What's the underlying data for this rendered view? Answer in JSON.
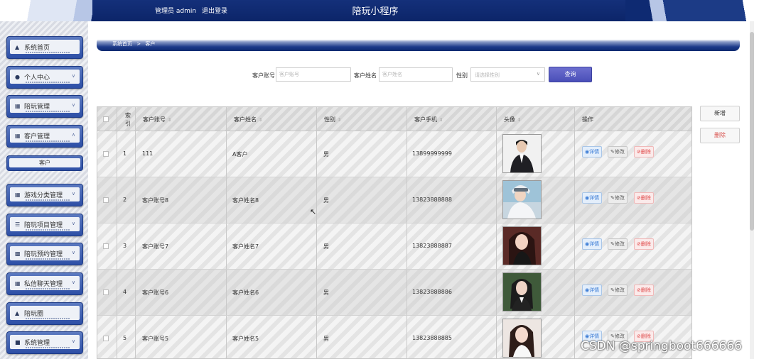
{
  "header": {
    "admin_role": "管理员 admin",
    "logout_label": "退出登录",
    "app_title": "陪玩小程序"
  },
  "sidebar": {
    "items": [
      {
        "label": "系统首页",
        "icon": "home-icon"
      },
      {
        "label": "个人中心",
        "icon": "user-icon"
      },
      {
        "label": "陪玩管理",
        "icon": "grid-icon"
      },
      {
        "label": "客户管理",
        "icon": "grid-icon"
      },
      {
        "label": "游戏分类管理",
        "icon": "grid-icon"
      },
      {
        "label": "陪玩项目管理",
        "icon": "list-icon"
      },
      {
        "label": "陪玩预约管理",
        "icon": "calendar-icon"
      },
      {
        "label": "私信聊天管理",
        "icon": "grid-icon"
      },
      {
        "label": "陪玩圈",
        "icon": "thumb-icon"
      },
      {
        "label": "系统管理",
        "icon": "system-icon"
      }
    ],
    "submenu_active": "客户"
  },
  "breadcrumb": {
    "home": "系统首页",
    "sep": ">",
    "current": "客户"
  },
  "search": {
    "account_label": "客户账号",
    "account_placeholder": "客户账号",
    "name_label": "客户姓名",
    "name_placeholder": "客户姓名",
    "gender_label": "性别",
    "gender_placeholder": "请选择性别",
    "query_label": "查询"
  },
  "actions": {
    "add_label": "新增",
    "delete_label": "删除"
  },
  "table": {
    "columns": [
      "索引",
      "客户账号",
      "客户姓名",
      "性别",
      "客户手机",
      "头像",
      "操作"
    ],
    "index_header_line1": "索",
    "index_header_line2": "引",
    "op_detail": "详情",
    "op_edit": "修改",
    "op_delete": "删除",
    "rows": [
      {
        "index": "1",
        "account": "111",
        "name": "A客户",
        "gender": "男",
        "phone": "13899999999"
      },
      {
        "index": "2",
        "account": "客户账号8",
        "name": "客户姓名8",
        "gender": "男",
        "phone": "13823888888"
      },
      {
        "index": "3",
        "account": "客户账号7",
        "name": "客户姓名7",
        "gender": "男",
        "phone": "13823888887"
      },
      {
        "index": "4",
        "account": "客户账号6",
        "name": "客户姓名6",
        "gender": "男",
        "phone": "13823888886"
      },
      {
        "index": "5",
        "account": "客户账号5",
        "name": "客户姓名5",
        "gender": "男",
        "phone": "13823888885"
      }
    ]
  },
  "watermark": "CSDN @springboot666666",
  "colors": {
    "header_navy": "#0c2569",
    "accent_purple": "#4a4fb8",
    "detail_blue": "#3a7bd5",
    "delete_red": "#e04b4b"
  }
}
